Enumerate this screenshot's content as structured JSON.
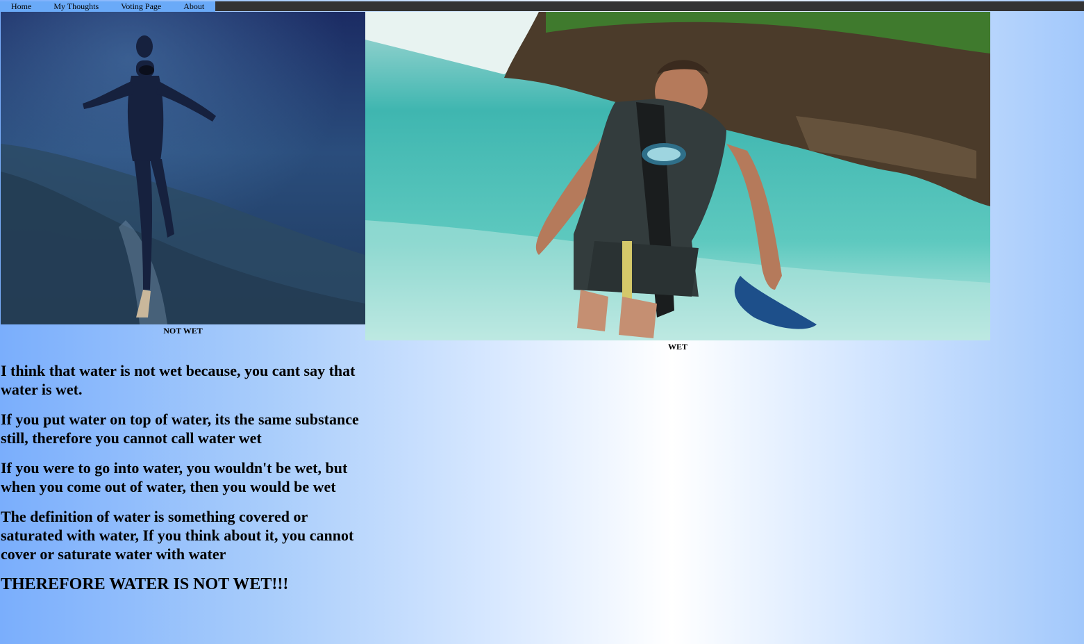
{
  "nav": {
    "items": [
      {
        "label": "Home"
      },
      {
        "label": "My Thoughts"
      },
      {
        "label": "Voting Page"
      },
      {
        "label": "About"
      }
    ]
  },
  "figures": {
    "left": {
      "caption": "NOT WET",
      "image": "underwater-freediver-photo"
    },
    "right": {
      "caption": "WET",
      "image": "scuba-diver-leaving-sea-photo"
    }
  },
  "content": {
    "paragraphs": [
      "I think that water is not wet because, you cant say that water is wet.",
      "If you put water on top of water, its the same substance still, therefore you cannot call water wet",
      "If you were to go into water, you wouldn't be wet, but when you come out of water, then you would be wet",
      "The definition of water is something covered or saturated with water, If you think about it, you cannot cover or saturate water with water"
    ],
    "conclusion": "THEREFORE WATER IS NOT WET!!!"
  },
  "colors": {
    "topbar": "#333333",
    "nav_background": "#6aaaf8",
    "gradient_edge": "#7aaefc",
    "gradient_center": "#ffffff"
  }
}
